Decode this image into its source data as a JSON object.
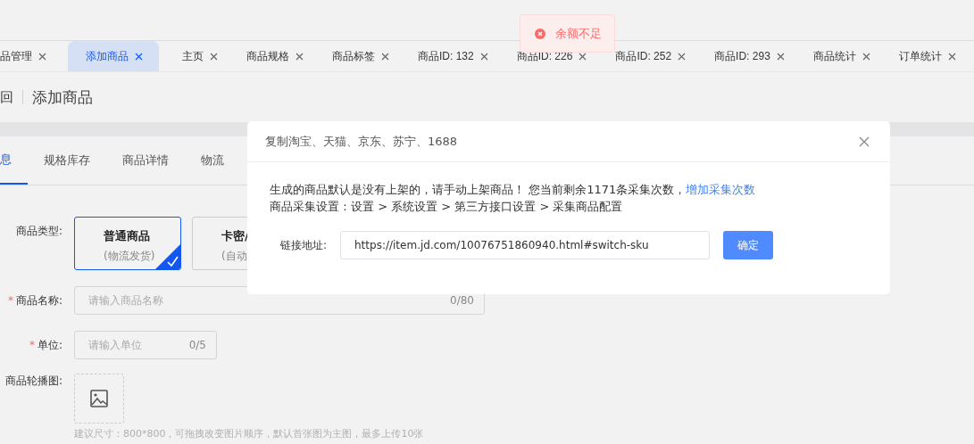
{
  "toast": {
    "kind": "error",
    "text": "余额不足"
  },
  "tabs": [
    {
      "label": "品管理",
      "selected": false
    },
    {
      "label": "添加商品",
      "selected": true
    },
    {
      "label": "主页",
      "selected": false
    },
    {
      "label": "商品规格",
      "selected": false
    },
    {
      "label": "商品标签",
      "selected": false
    },
    {
      "label": "商品ID: 132",
      "selected": false
    },
    {
      "label": "商品ID: 226",
      "selected": false
    },
    {
      "label": "商品ID: 252",
      "selected": false
    },
    {
      "label": "商品ID: 293",
      "selected": false
    },
    {
      "label": "商品统计",
      "selected": false
    },
    {
      "label": "订单统计",
      "selected": false
    }
  ],
  "header": {
    "back": "回",
    "title": "添加商品"
  },
  "section_tabs": [
    {
      "label": "息",
      "selected": true
    },
    {
      "label": "规格库存",
      "selected": false
    },
    {
      "label": "商品详情",
      "selected": false
    },
    {
      "label": "物流",
      "selected": false
    }
  ],
  "form": {
    "type_label": "商品类型:",
    "types": [
      {
        "title": "普通商品",
        "subtitle": "(物流发货)",
        "selected": true
      },
      {
        "title": "卡密/",
        "subtitle": "(自动",
        "selected": false
      }
    ],
    "name": {
      "label": "商品名称:",
      "required_mark": "*",
      "placeholder": "请输入商品名称",
      "count": "0/80"
    },
    "unit": {
      "label": "单位:",
      "required_mark": "*",
      "placeholder": "请输入单位",
      "count": "0/5"
    },
    "images": {
      "label": "商品轮播图:",
      "hint": "建议尺寸：800*800，可拖拽改变图片顺序，默认首张图为主图，最多上传10张"
    }
  },
  "dialog": {
    "title": "复制淘宝、天猫、京东、苏宁、1688",
    "line_1": "生成的商品默认是没有上架的，请手动上架商品！ 您当前剩余1171条采集次数，",
    "link": "增加采集次数",
    "line_2": "商品采集设置：设置 > 系统设置 > 第三方接口设置 > 采集商品配置",
    "url_label": "链接地址:",
    "url_value": "https://item.jd.com/10076751860940.html#switch-sku",
    "confirm": "确定"
  }
}
